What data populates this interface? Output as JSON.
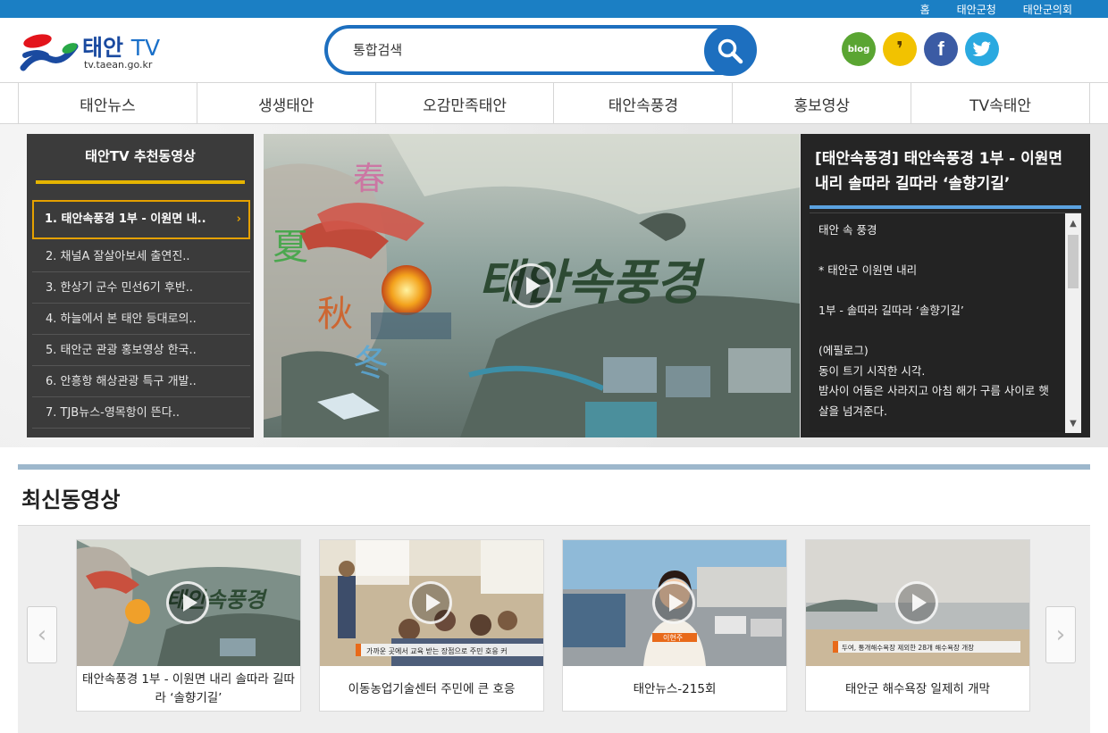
{
  "topbar": {
    "links": [
      "홈",
      "태안군청",
      "태안군의회"
    ]
  },
  "header": {
    "brand": "태안",
    "brand_tv": "TV",
    "url": "tv.taean.go.kr",
    "search_placeholder": "통합검색",
    "social": {
      "blog": "blog",
      "story": "❜",
      "facebook": "f"
    }
  },
  "nav": [
    "태안뉴스",
    "생생태안",
    "오감만족태안",
    "태안속풍경",
    "홍보영상",
    "TV속태안"
  ],
  "recommend": {
    "title": "태안TV 추천동영상",
    "items": [
      "1. 태안속풍경 1부 - 이원면 내..",
      "2. 채널A 잘살아보세 출연진..",
      "3. 한상기 군수 민선6기 후반..",
      "4. 하늘에서 본 태안 등대로의..",
      "5. 태안군 관광 홍보영상 한국..",
      "6. 안흥항 해상관광 특구 개발..",
      "7. TJB뉴스-영목항이 뜬다.."
    ],
    "active_arrow": "›"
  },
  "player": {
    "overlay_title": "태안속풍경",
    "seasons": [
      "春",
      "夏",
      "秋",
      "冬"
    ]
  },
  "info": {
    "title": "[태안속풍경] 태안속풍경 1부 - 이원면 내리 솔따라 길따라 ‘솔향기길’",
    "lines": [
      "태안 속 풍경",
      "",
      "* 태안군 이원면 내리",
      "",
      "1부 - 솔따라 길따라 ‘솔향기길’",
      "",
      "(에필로그)",
      "동이 트기 시작한 시각.",
      "밤사이 어둠은 사라지고 아침 해가 구름 사이로 햇살을 넘겨준다."
    ]
  },
  "latest": {
    "title": "최신동영상",
    "prev": "‹",
    "next": "›",
    "cards": [
      {
        "caption": "태안속풍경 1부 - 이원면 내리 솔따라 길따라 ‘솔향기길’",
        "thumb_text": "태안속풍경"
      },
      {
        "caption": "이동농업기술센터 주민에 큰 호응",
        "thumb_text": "가까운 곳에서 교육 받는 장점으로 주민 호응 커"
      },
      {
        "caption": "태안뉴스-215회",
        "thumb_text": "이현주"
      },
      {
        "caption": "태안군 해수욕장 일제히 개막",
        "thumb_text": "두여, 통개해수욕장 제외한 28개 해수욕장 개장"
      }
    ]
  },
  "colors": {
    "topbar": "#1b7fc4",
    "search_border": "#1d6fbf",
    "accent_gold": "#e5a100",
    "info_bar": "#5ba2e0"
  }
}
